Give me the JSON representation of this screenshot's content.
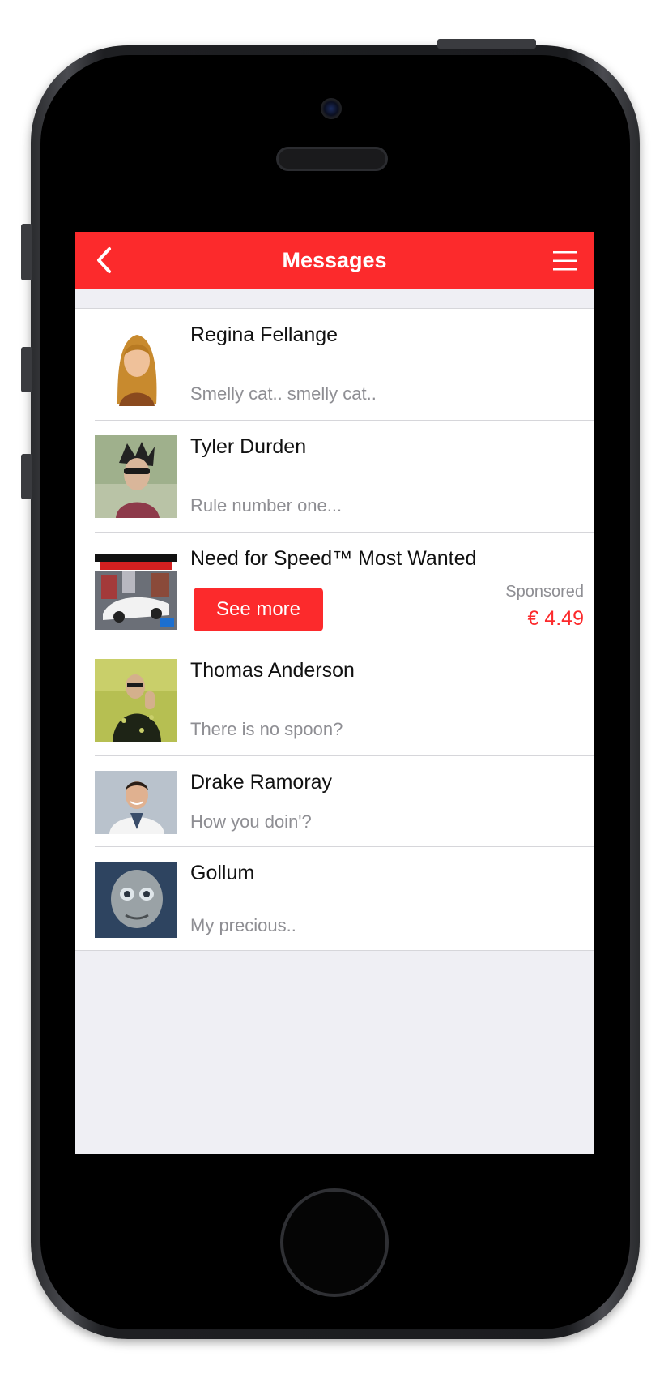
{
  "app": {
    "title": "Messages",
    "accent_color": "#fc2a2c",
    "back_icon": "chevron-left-icon",
    "menu_icon": "hamburger-menu-icon"
  },
  "messages": [
    {
      "name": "Regina Fellange",
      "preview": "Smelly cat.. smelly cat..",
      "avatar": "avatar-photo-blonde-woman"
    },
    {
      "name": "Tyler Durden",
      "preview": "Rule number one...",
      "avatar": "avatar-illustration-man-sunglasses"
    },
    {
      "name": "Thomas Anderson",
      "preview": "There is no spoon?",
      "avatar": "avatar-photo-man-black-coat"
    },
    {
      "name": "Drake Ramoray",
      "preview": "How you doin'?",
      "avatar": "avatar-photo-doctor"
    },
    {
      "name": "Gollum",
      "preview": "My precious..",
      "avatar": "avatar-photo-creature"
    }
  ],
  "sponsored_item": {
    "title": "Need for Speed™ Most Wanted",
    "button_label": "See more",
    "sponsored_label": "Sponsored",
    "price": "€ 4.49",
    "thumbnail": "game-cover-race-car"
  }
}
